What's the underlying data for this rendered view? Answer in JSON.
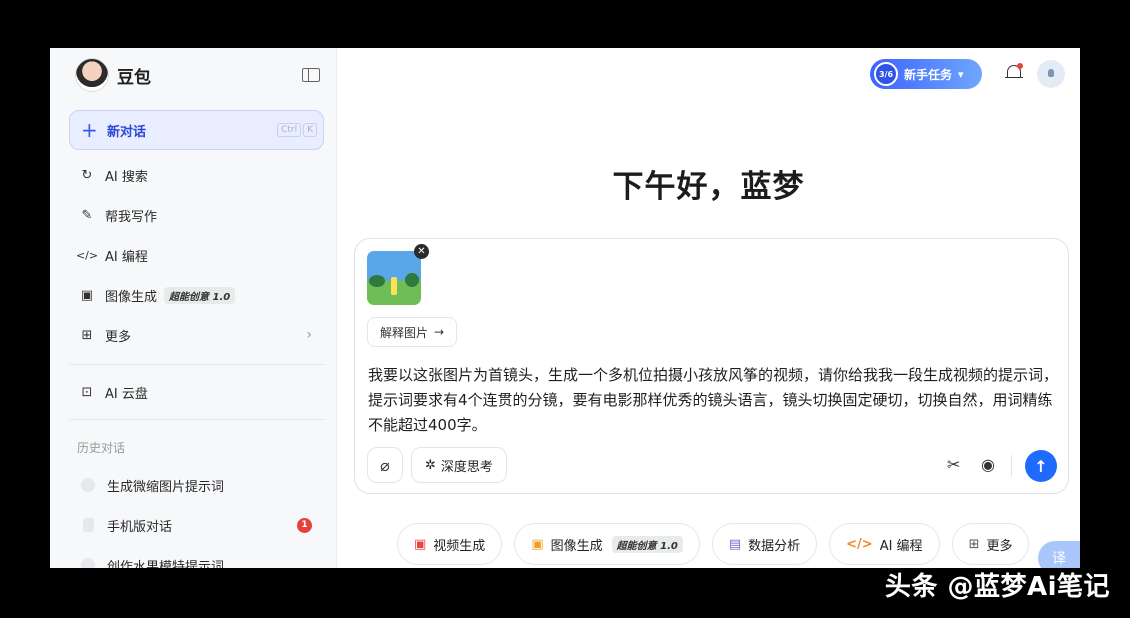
{
  "brand": {
    "name": "豆包"
  },
  "sidebar": {
    "new_chat": {
      "label": "新对话",
      "shortcut": [
        "Ctrl",
        "K"
      ]
    },
    "items": [
      {
        "label": "AI 搜索",
        "icon": "search-icon"
      },
      {
        "label": "帮我写作",
        "icon": "pen-icon"
      },
      {
        "label": "AI 编程",
        "icon": "code-icon"
      },
      {
        "label": "图像生成",
        "icon": "image-icon",
        "badge": "超能创意 1.0"
      },
      {
        "label": "更多",
        "icon": "apps-icon"
      }
    ],
    "cloud": {
      "label": "AI 云盘",
      "icon": "cloud-drive-icon"
    },
    "history_title": "历史对话",
    "history": [
      {
        "label": "生成微缩图片提示词"
      },
      {
        "label": "手机版对话",
        "badge": "1"
      },
      {
        "label": "创作水果模特提示词"
      }
    ]
  },
  "header": {
    "task": {
      "progress": "3/6",
      "label": "新手任务"
    }
  },
  "main": {
    "greeting": "下午好，蓝梦",
    "composer": {
      "explain_chip": "解释图片",
      "prompt_text": "我要以这张图片为首镜头，生成一个多机位拍摄小孩放风筝的视频，请你给我我一段生成视频的提示词，提示词要求有4个连贯的分镜，要有电影那样优秀的镜头语言，镜头切换固定硬切，切换自然，用词精练不能超过400字。",
      "deep_think": "深度思考"
    },
    "quick_actions": [
      {
        "label": "视频生成",
        "icon": "video-icon"
      },
      {
        "label": "图像生成",
        "icon": "image-icon",
        "badge": "超能创意 1.0"
      },
      {
        "label": "数据分析",
        "icon": "chart-icon"
      },
      {
        "label": "AI 编程",
        "icon": "code-icon"
      },
      {
        "label": "更多",
        "icon": "apps-icon"
      }
    ],
    "translate": "译"
  },
  "watermark": "头条 @蓝梦Ai笔记"
}
